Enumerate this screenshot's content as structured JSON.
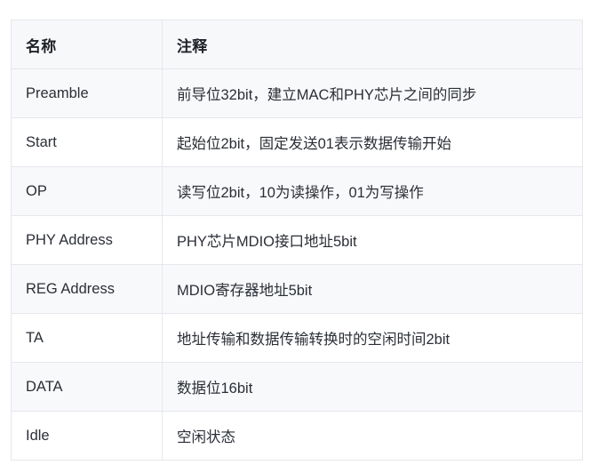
{
  "table": {
    "columns": [
      {
        "key": "name",
        "label": "名称"
      },
      {
        "key": "note",
        "label": "注释"
      }
    ],
    "rows": [
      {
        "name": "Preamble",
        "note": "前导位32bit，建立MAC和PHY芯片之间的同步"
      },
      {
        "name": "Start",
        "note": "起始位2bit，固定发送01表示数据传输开始"
      },
      {
        "name": "OP",
        "note": "读写位2bit，10为读操作，01为写操作"
      },
      {
        "name": "PHY Address",
        "note": "PHY芯片MDIO接口地址5bit"
      },
      {
        "name": "REG Address",
        "note": "MDIO寄存器地址5bit"
      },
      {
        "name": "TA",
        "note": "地址传输和数据传输转换时的空闲时间2bit"
      },
      {
        "name": "DATA",
        "note": "数据位16bit"
      },
      {
        "name": "Idle",
        "note": "空闲状态"
      }
    ]
  },
  "colors": {
    "page_background": "#ffffff",
    "header_background": "#f7f8fa",
    "row_alt_background": "#f8f9fb",
    "row_plain_background": "#ffffff",
    "border": "#e5e7ec",
    "header_text": "#20232a",
    "body_text": "#2b2f36"
  }
}
